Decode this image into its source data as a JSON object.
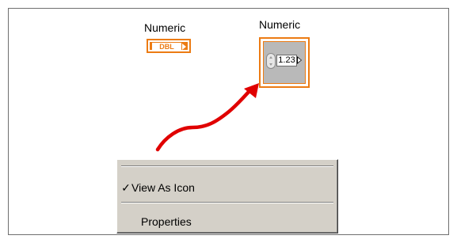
{
  "diagram": {
    "left_terminal": {
      "label": "Numeric",
      "type_text": "DBL"
    },
    "right_terminal": {
      "label": "Numeric",
      "value": "1.23"
    }
  },
  "context_menu": {
    "items": [
      {
        "check": "✓",
        "label": "View As Icon"
      },
      {
        "check": "",
        "label": "Properties"
      }
    ]
  },
  "colors": {
    "terminal_orange": "#ec7b13",
    "arrow_red": "#e00000",
    "menu_bg": "#d4d0c8"
  },
  "icons": [
    "spinner-icon",
    "output-arrow-icon",
    "red-pointer-arrow-icon",
    "checkmark-icon"
  ]
}
